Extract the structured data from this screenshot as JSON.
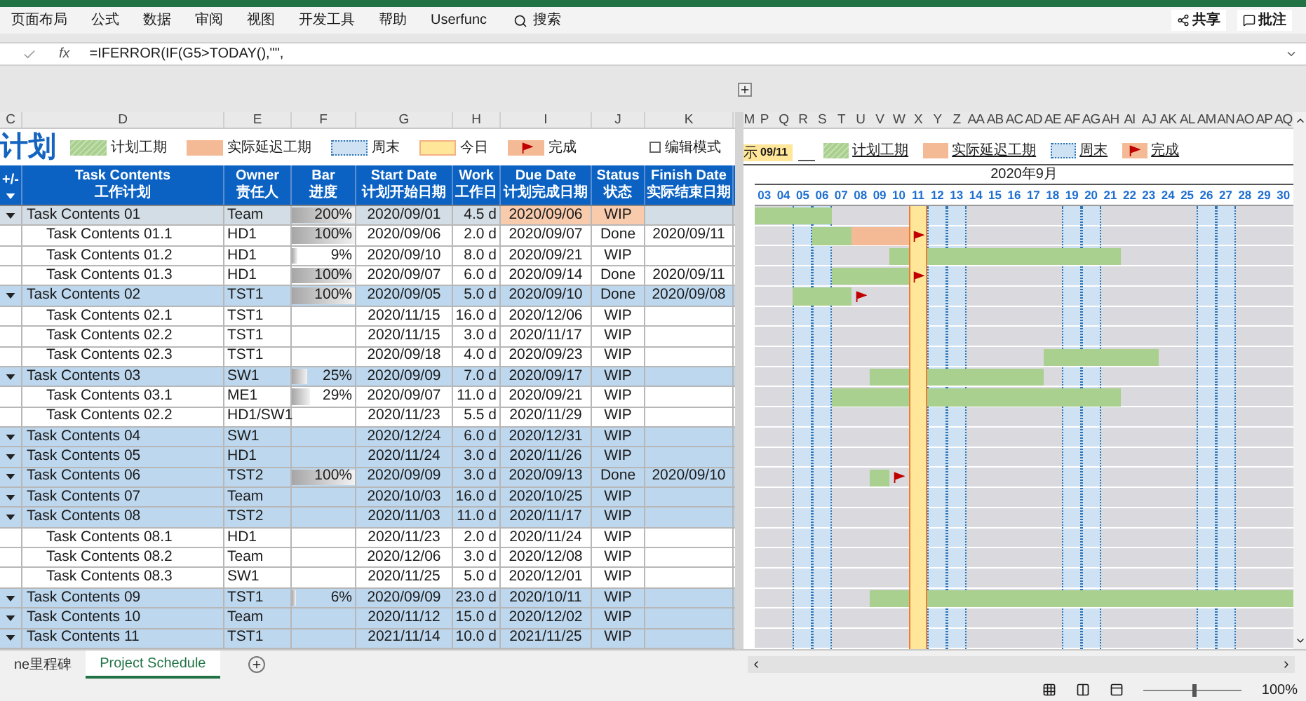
{
  "ribbon_tabs": [
    "页面布局",
    "公式",
    "数据",
    "审阅",
    "视图",
    "开发工具",
    "帮助",
    "Userfunc"
  ],
  "search": {
    "label": "搜索"
  },
  "share_button": "共享",
  "comments_button": "批注",
  "formula_bar": {
    "fx": "fx",
    "formula": "=IFERROR(IF(G5>TODAY(),\"\","
  },
  "column_headers_left": [
    "C",
    "D",
    "E",
    "F",
    "G",
    "H",
    "I",
    "J",
    "K"
  ],
  "column_headers_right": [
    "M",
    "P",
    "Q",
    "R",
    "S",
    "T",
    "U",
    "V",
    "W",
    "X",
    "Y",
    "Z",
    "AA",
    "AB",
    "AC",
    "AD",
    "AE",
    "AF",
    "AG",
    "AH",
    "AI",
    "AJ",
    "AK",
    "AL",
    "AM",
    "AN",
    "AO",
    "AP",
    "AQ"
  ],
  "title": "计划",
  "legend": [
    {
      "kind": "plan",
      "label": "计划工期"
    },
    {
      "kind": "delay",
      "label": "实际延迟工期"
    },
    {
      "kind": "weekend",
      "label": "周末"
    },
    {
      "kind": "today",
      "label": "今日"
    },
    {
      "kind": "done",
      "label": "完成"
    }
  ],
  "edit_mode": {
    "label": "编辑模式",
    "checked": false
  },
  "today_label": {
    "prefix": "示",
    "date": "09/11"
  },
  "gantt_legend": [
    {
      "kind": "plan",
      "label": "计划工期"
    },
    {
      "kind": "delay",
      "label": "实际延迟工期"
    },
    {
      "kind": "weekend",
      "label": "周末"
    },
    {
      "kind": "done",
      "label": "完成"
    }
  ],
  "month": "2020年9月",
  "days": [
    {
      "label": "03",
      "kind": "weekday"
    },
    {
      "label": "04",
      "kind": "weekday"
    },
    {
      "label": "05",
      "kind": "weekend"
    },
    {
      "label": "06",
      "kind": "weekend"
    },
    {
      "label": "07",
      "kind": "weekday"
    },
    {
      "label": "08",
      "kind": "weekday"
    },
    {
      "label": "09",
      "kind": "weekday"
    },
    {
      "label": "10",
      "kind": "weekday"
    },
    {
      "label": "11",
      "kind": "today"
    },
    {
      "label": "12",
      "kind": "weekend"
    },
    {
      "label": "13",
      "kind": "weekend"
    },
    {
      "label": "14",
      "kind": "weekday"
    },
    {
      "label": "15",
      "kind": "weekday"
    },
    {
      "label": "16",
      "kind": "weekday"
    },
    {
      "label": "17",
      "kind": "weekday"
    },
    {
      "label": "18",
      "kind": "weekday"
    },
    {
      "label": "19",
      "kind": "weekend"
    },
    {
      "label": "20",
      "kind": "weekend"
    },
    {
      "label": "21",
      "kind": "weekday"
    },
    {
      "label": "22",
      "kind": "weekday"
    },
    {
      "label": "23",
      "kind": "weekday"
    },
    {
      "label": "24",
      "kind": "weekday"
    },
    {
      "label": "25",
      "kind": "weekday"
    },
    {
      "label": "26",
      "kind": "weekend"
    },
    {
      "label": "27",
      "kind": "weekend"
    },
    {
      "label": "28",
      "kind": "weekday"
    },
    {
      "label": "29",
      "kind": "weekday"
    },
    {
      "label": "30",
      "kind": "weekday"
    }
  ],
  "table": {
    "columns": [
      {
        "en": "+/-"
      },
      {
        "en": "Task Contents",
        "zh": "工作计划"
      },
      {
        "en": "Owner",
        "zh": "责任人"
      },
      {
        "en": "Bar",
        "zh": "进度"
      },
      {
        "en": "Start Date",
        "zh": "计划开始日期"
      },
      {
        "en": "Work",
        "zh": "工作日"
      },
      {
        "en": "Due Date",
        "zh": "计划完成日期"
      },
      {
        "en": "Status",
        "zh": "状态"
      },
      {
        "en": "Finish Date",
        "zh": "实际结束日期"
      }
    ],
    "rows": [
      {
        "task": "Task Contents 01",
        "owner": "Team",
        "progress": "200%",
        "level": 1,
        "start": "2020/09/01",
        "work": "4.5 d",
        "due": "2020/09/06",
        "status": "WIP",
        "selected": true,
        "overdue": true,
        "children": [
          {
            "task": "Task Contents 01.1",
            "owner": "HD1",
            "progress": "100%",
            "level": 1,
            "start": "2020/09/06",
            "work": "2.0 d",
            "due": "2020/09/07",
            "status": "Done",
            "finish": "2020/09/11",
            "selected": false,
            "overdue": false
          },
          {
            "task": "Task Contents 01.2",
            "owner": "HD1",
            "progress": "9%",
            "level": 0.09,
            "start": "2020/09/10",
            "work": "8.0 d",
            "due": "2020/09/21",
            "status": "WIP",
            "selected": false,
            "overdue": false
          },
          {
            "task": "Task Contents 01.3",
            "owner": "HD1",
            "progress": "100%",
            "level": 1,
            "start": "2020/09/07",
            "work": "6.0 d",
            "due": "2020/09/14",
            "status": "Done",
            "finish": "2020/09/11",
            "selected": false,
            "overdue": false
          }
        ]
      },
      {
        "task": "Task Contents 02",
        "owner": "TST1",
        "progress": "100%",
        "level": 1,
        "start": "2020/09/05",
        "work": "5.0 d",
        "due": "2020/09/10",
        "status": "Done",
        "finish": "2020/09/08",
        "selected": false,
        "overdue": false,
        "children": [
          {
            "task": "Task Contents 02.1",
            "owner": "TST1",
            "start": "2020/11/15",
            "work": "16.0 d",
            "due": "2020/12/06",
            "status": "WIP",
            "selected": false,
            "overdue": false
          },
          {
            "task": "Task Contents 02.2",
            "owner": "TST1",
            "start": "2020/11/15",
            "work": "3.0 d",
            "due": "2020/11/17",
            "status": "WIP",
            "selected": false,
            "overdue": false
          },
          {
            "task": "Task Contents 02.3",
            "owner": "TST1",
            "start": "2020/09/18",
            "work": "4.0 d",
            "due": "2020/09/23",
            "status": "WIP",
            "selected": false,
            "overdue": false
          }
        ]
      },
      {
        "task": "Task Contents 03",
        "owner": "SW1",
        "progress": "25%",
        "level": 0.25,
        "start": "2020/09/09",
        "work": "7.0 d",
        "due": "2020/09/17",
        "status": "WIP",
        "selected": false,
        "overdue": false,
        "children": [
          {
            "task": "Task Contents 03.1",
            "owner": "ME1",
            "progress": "29%",
            "level": 0.29,
            "start": "2020/09/07",
            "work": "11.0 d",
            "due": "2020/09/21",
            "status": "WIP",
            "selected": false,
            "overdue": false
          },
          {
            "task": "Task Contents 02.2",
            "owner": "HD1/SW1",
            "start": "2020/11/23",
            "work": "5.5 d",
            "due": "2020/11/29",
            "status": "WIP",
            "selected": false,
            "overdue": false
          }
        ]
      },
      {
        "task": "Task Contents 04",
        "owner": "SW1",
        "start": "2020/12/24",
        "work": "6.0 d",
        "due": "2020/12/31",
        "status": "WIP",
        "selected": false,
        "overdue": false
      },
      {
        "task": "Task Contents 05",
        "owner": "HD1",
        "start": "2020/11/24",
        "work": "3.0 d",
        "due": "2020/11/26",
        "status": "WIP",
        "selected": false,
        "overdue": false
      },
      {
        "task": "Task Contents 06",
        "owner": "TST2",
        "progress": "100%",
        "level": 1,
        "start": "2020/09/09",
        "work": "3.0 d",
        "due": "2020/09/13",
        "status": "Done",
        "finish": "2020/09/10",
        "selected": false,
        "overdue": false
      },
      {
        "task": "Task Contents 07",
        "owner": "Team",
        "start": "2020/10/03",
        "work": "16.0 d",
        "due": "2020/10/25",
        "status": "WIP",
        "selected": false,
        "overdue": false
      },
      {
        "task": "Task Contents 08",
        "owner": "TST2",
        "start": "2020/11/03",
        "work": "11.0 d",
        "due": "2020/11/17",
        "status": "WIP",
        "selected": false,
        "overdue": false,
        "children": [
          {
            "task": "Task Contents 08.1",
            "owner": "HD1",
            "start": "2020/11/23",
            "work": "2.0 d",
            "due": "2020/11/24",
            "status": "WIP",
            "selected": false,
            "overdue": false
          },
          {
            "task": "Task Contents 08.2",
            "owner": "Team",
            "start": "2020/12/06",
            "work": "3.0 d",
            "due": "2020/12/08",
            "status": "WIP",
            "selected": false,
            "overdue": false
          },
          {
            "task": "Task Contents 08.3",
            "owner": "SW1",
            "start": "2020/11/25",
            "work": "5.0 d",
            "due": "2020/12/01",
            "status": "WIP",
            "selected": false,
            "overdue": false
          }
        ]
      },
      {
        "task": "Task Contents 09",
        "owner": "TST1",
        "progress": "6%",
        "level": 0.06,
        "start": "2020/09/09",
        "work": "23.0 d",
        "due": "2020/10/11",
        "status": "WIP",
        "selected": false,
        "overdue": false
      },
      {
        "task": "Task Contents 10",
        "owner": "Team",
        "start": "2020/11/12",
        "work": "15.0 d",
        "due": "2020/12/02",
        "status": "WIP",
        "selected": false,
        "overdue": false
      },
      {
        "task": "Task Contents 11",
        "owner": "TST1",
        "start": "2021/11/14",
        "work": "10.0 d",
        "due": "2021/11/25",
        "status": "WIP",
        "selected": false,
        "overdue": false
      }
    ]
  },
  "sheet_tabs": [
    {
      "label": "ne里程碑",
      "selected": false
    },
    {
      "label": "Project Schedule",
      "selected": true
    }
  ],
  "zoom": {
    "label": "100%",
    "level": 0.5
  }
}
